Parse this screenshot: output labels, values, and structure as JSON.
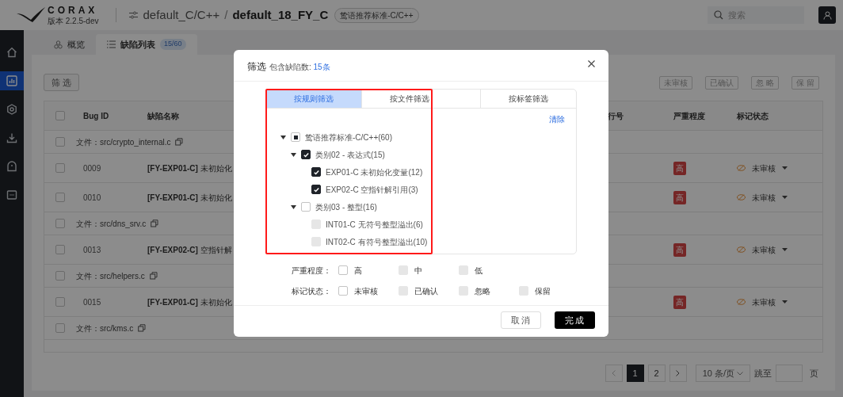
{
  "header": {
    "logo_text": "CORAX",
    "version": "版本 2.2.5-dev",
    "project": "default_C/C++",
    "separator": "/",
    "task": "default_18_FY_C",
    "rule_tag": "鸷语推荐标准-C/C++",
    "search": {
      "placeholder": "搜索"
    }
  },
  "sidebar": {
    "items": [
      {
        "kind": "home",
        "selected": false
      },
      {
        "kind": "chart",
        "selected": true
      },
      {
        "kind": "gear",
        "selected": false
      },
      {
        "kind": "download",
        "selected": false
      },
      {
        "kind": "alert",
        "selected": false
      },
      {
        "kind": "card",
        "selected": false
      }
    ]
  },
  "tabs": [
    {
      "kind": "overview",
      "label": "概览",
      "selected": false
    },
    {
      "kind": "list",
      "label": "缺陷列表",
      "badge": "15/60",
      "selected": true
    }
  ],
  "toolbar": {
    "filter_button": "筛 选",
    "actions": [
      "未审核",
      "已确认",
      "忽 略",
      "保 留"
    ]
  },
  "table": {
    "select_all_checked": false,
    "columns": [
      "Bug ID",
      "缺陷名称",
      "行号",
      "严重程度",
      "标记状态"
    ],
    "rows": [
      {
        "kind": "file",
        "checked": false,
        "label": "文件：",
        "path": "src/crypto_internal.c"
      },
      {
        "kind": "bug",
        "checked": false,
        "id": "0009",
        "rule": "[FY-EXP01-C]",
        "name": "未初始化",
        "severity": "高",
        "status": "未审核"
      },
      {
        "kind": "bug",
        "checked": false,
        "id": "0010",
        "rule": "[FY-EXP01-C]",
        "name": "未初始化",
        "severity": "高",
        "status": "未审核"
      },
      {
        "kind": "file",
        "checked": false,
        "label": "文件：",
        "path": "src/dns_srv.c"
      },
      {
        "kind": "bug",
        "checked": false,
        "id": "0013",
        "rule": "[FY-EXP02-C]",
        "name": "空指针解",
        "severity": "高",
        "status": "未审核"
      },
      {
        "kind": "file",
        "checked": false,
        "label": "文件：",
        "path": "src/helpers.c"
      },
      {
        "kind": "bug",
        "checked": false,
        "id": "0015",
        "rule": "[FY-EXP01-C]",
        "name": "未初始化",
        "severity": "高",
        "status": "未审核"
      },
      {
        "kind": "file",
        "checked": false,
        "label": "文件：",
        "path": "src/kms.c"
      }
    ]
  },
  "pagination": {
    "pages": [
      {
        "label": "1",
        "selected": true
      },
      {
        "label": "2",
        "selected": false
      }
    ],
    "page_size": "10 条/页",
    "jump_label": "跳至",
    "page_unit": "页"
  },
  "dialog": {
    "title": "筛选",
    "count_label": "包含缺陷数:",
    "count": "15条",
    "tabs": [
      {
        "label": "按规则筛选",
        "selected": true
      },
      {
        "label": "按文件筛选",
        "selected": false
      },
      {
        "label": "按标签筛选",
        "selected": false
      }
    ],
    "clear": "清除",
    "tree": [
      {
        "label": "鸷语推荐标准-C/C++(60)",
        "indeterminate": true,
        "expanded": true,
        "disabled": false,
        "children": [
          {
            "label": "类别02 - 表达式(15)",
            "checked": true,
            "expanded": true,
            "disabled": false,
            "children": [
              {
                "label": "EXP01-C 未初始化变量(12)",
                "checked": true,
                "disabled": false
              },
              {
                "label": "EXP02-C 空指针解引用(3)",
                "checked": true,
                "disabled": false
              }
            ]
          },
          {
            "label": "类别03 - 整型(16)",
            "checked": false,
            "expanded": true,
            "disabled": false,
            "children": [
              {
                "label": "INT01-C 无符号整型溢出(6)",
                "checked": false,
                "disabled": true
              },
              {
                "label": "INT02-C 有符号整型溢出(10)",
                "checked": false,
                "disabled": true
              }
            ]
          }
        ]
      }
    ],
    "severity": {
      "label": "严重程度：",
      "options": [
        {
          "label": "高",
          "checked": false,
          "disabled": false
        },
        {
          "label": "中",
          "checked": false,
          "disabled": true
        },
        {
          "label": "低",
          "checked": false,
          "disabled": true
        }
      ]
    },
    "status": {
      "label": "标记状态：",
      "options": [
        {
          "label": "未审核",
          "checked": false,
          "disabled": false
        },
        {
          "label": "已确认",
          "checked": false,
          "disabled": true
        },
        {
          "label": "忽略",
          "checked": false,
          "disabled": true
        },
        {
          "label": "保留",
          "checked": false,
          "disabled": true
        }
      ]
    },
    "cancel": "取消",
    "confirm": "完成"
  }
}
